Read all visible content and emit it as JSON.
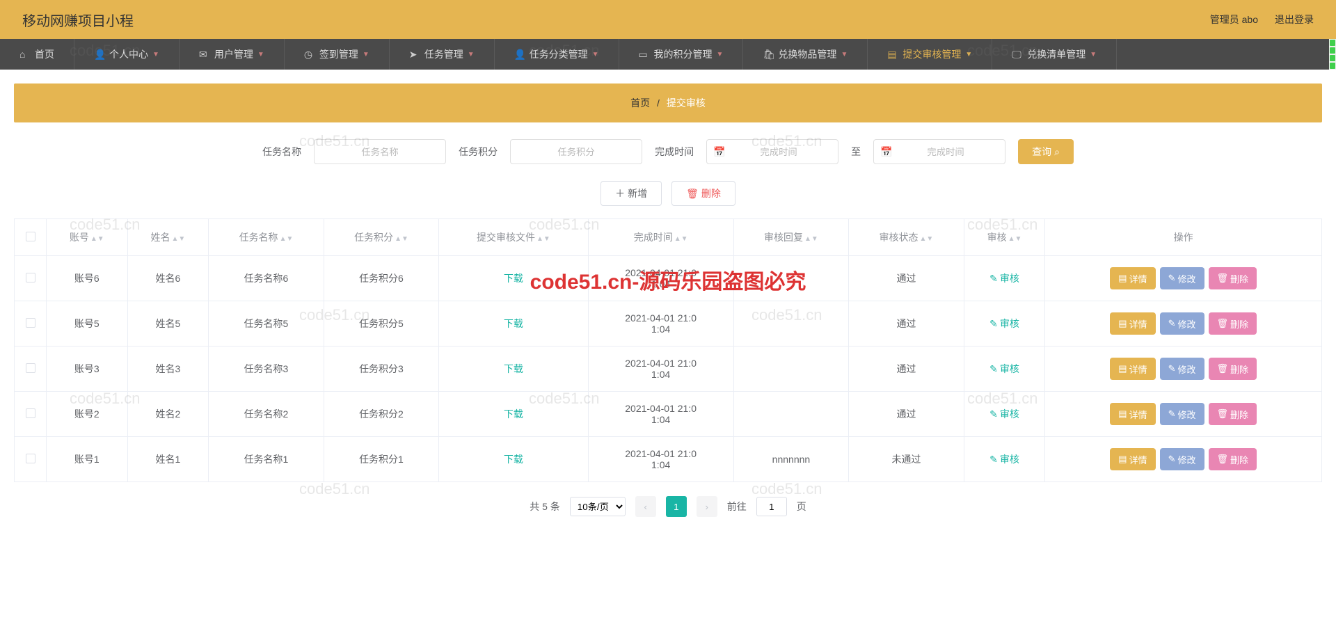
{
  "header": {
    "title": "移动网赚项目小程",
    "user": "管理员 abo",
    "logout": "退出登录"
  },
  "nav": [
    {
      "label": "首页",
      "icon": "home",
      "caret": false
    },
    {
      "label": "个人中心",
      "icon": "user",
      "caret": true
    },
    {
      "label": "用户管理",
      "icon": "mail",
      "caret": true
    },
    {
      "label": "签到管理",
      "icon": "clock",
      "caret": true
    },
    {
      "label": "任务管理",
      "icon": "send",
      "caret": true
    },
    {
      "label": "任务分类管理",
      "icon": "user",
      "caret": true
    },
    {
      "label": "我的积分管理",
      "icon": "card",
      "caret": true
    },
    {
      "label": "兑换物品管理",
      "icon": "bag",
      "caret": true
    },
    {
      "label": "提交审核管理",
      "icon": "doc",
      "caret": true,
      "active": true
    },
    {
      "label": "兑换清单管理",
      "icon": "monitor",
      "caret": true
    }
  ],
  "breadcrumb": {
    "home": "首页",
    "sep": "/",
    "current": "提交审核"
  },
  "filters": {
    "name_label": "任务名称",
    "name_ph": "任务名称",
    "score_label": "任务积分",
    "score_ph": "任务积分",
    "time_label": "完成时间",
    "time_ph": "完成时间",
    "to": "至",
    "query": "查询"
  },
  "toolbar": {
    "add": "新增",
    "del": "删除"
  },
  "columns": [
    "账号",
    "姓名",
    "任务名称",
    "任务积分",
    "提交审核文件",
    "完成时间",
    "审核回复",
    "审核状态",
    "审核",
    "操作"
  ],
  "download_label": "下载",
  "audit_label": "审核",
  "actions": {
    "detail": "详情",
    "edit": "修改",
    "del": "删除"
  },
  "rows": [
    {
      "acct": "账号6",
      "name": "姓名6",
      "task": "任务名称6",
      "score": "任务积分6",
      "file": "下载",
      "time": "2021-04-01 21:01:04",
      "reply": "",
      "status": "通过"
    },
    {
      "acct": "账号5",
      "name": "姓名5",
      "task": "任务名称5",
      "score": "任务积分5",
      "file": "下载",
      "time": "2021-04-01 21:01:04",
      "reply": "",
      "status": "通过"
    },
    {
      "acct": "账号3",
      "name": "姓名3",
      "task": "任务名称3",
      "score": "任务积分3",
      "file": "下载",
      "time": "2021-04-01 21:01:04",
      "reply": "",
      "status": "通过"
    },
    {
      "acct": "账号2",
      "name": "姓名2",
      "task": "任务名称2",
      "score": "任务积分2",
      "file": "下载",
      "time": "2021-04-01 21:01:04",
      "reply": "",
      "status": "通过"
    },
    {
      "acct": "账号1",
      "name": "姓名1",
      "task": "任务名称1",
      "score": "任务积分1",
      "file": "下载",
      "time": "2021-04-01 21:01:04",
      "reply": "nnnnnnn",
      "status": "未通过"
    }
  ],
  "pager": {
    "total": "共 5 条",
    "size": "10条/页",
    "page": "1",
    "goto": "前往",
    "page_unit": "页"
  },
  "watermark_main": "code51.cn-源码乐园盗图必究",
  "watermark_small": "code51.cn"
}
